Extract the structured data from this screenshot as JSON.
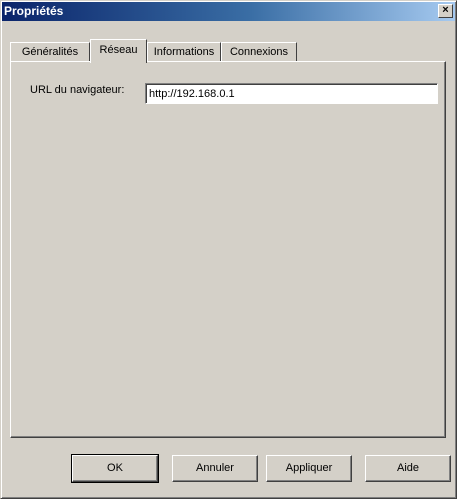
{
  "window": {
    "title": "Propriétés",
    "close_glyph": "×"
  },
  "tabs": [
    {
      "label": "Généralités",
      "active": false
    },
    {
      "label": "Réseau",
      "active": true
    },
    {
      "label": "Informations",
      "active": false
    },
    {
      "label": "Connexions",
      "active": false
    }
  ],
  "network": {
    "url_label": "URL du navigateur:",
    "url_value": "http://192.168.0.1"
  },
  "buttons": {
    "ok": "OK",
    "cancel": "Annuler",
    "apply": "Appliquer",
    "help": "Aide"
  },
  "colors": {
    "face": "#d4d0c8",
    "title_start": "#0a246a",
    "title_end": "#a6caf0"
  }
}
